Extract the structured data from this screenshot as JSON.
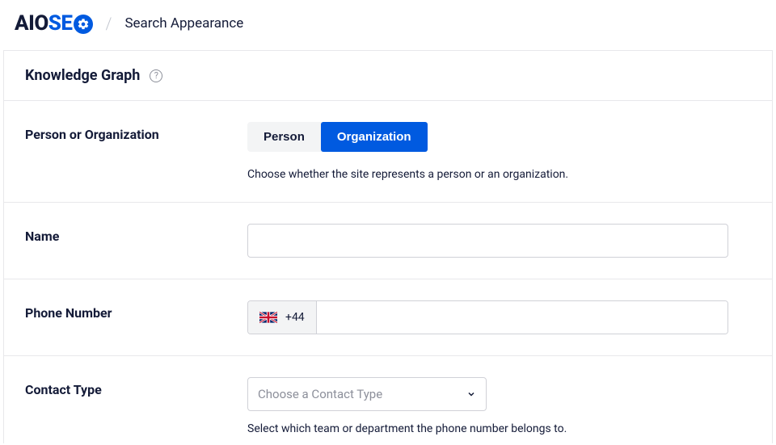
{
  "logo": {
    "part1": "AIO",
    "part2": "SE"
  },
  "breadcrumb": {
    "title": "Search Appearance"
  },
  "card": {
    "title": "Knowledge Graph"
  },
  "fields": {
    "entity": {
      "label": "Person or Organization",
      "options": {
        "person": "Person",
        "organization": "Organization"
      },
      "desc": "Choose whether the site represents a person or an organization."
    },
    "name": {
      "label": "Name",
      "value": ""
    },
    "phone": {
      "label": "Phone Number",
      "dial_code": "+44",
      "value": ""
    },
    "contact": {
      "label": "Contact Type",
      "placeholder": "Choose a Contact Type",
      "desc": "Select which team or department the phone number belongs to."
    }
  }
}
